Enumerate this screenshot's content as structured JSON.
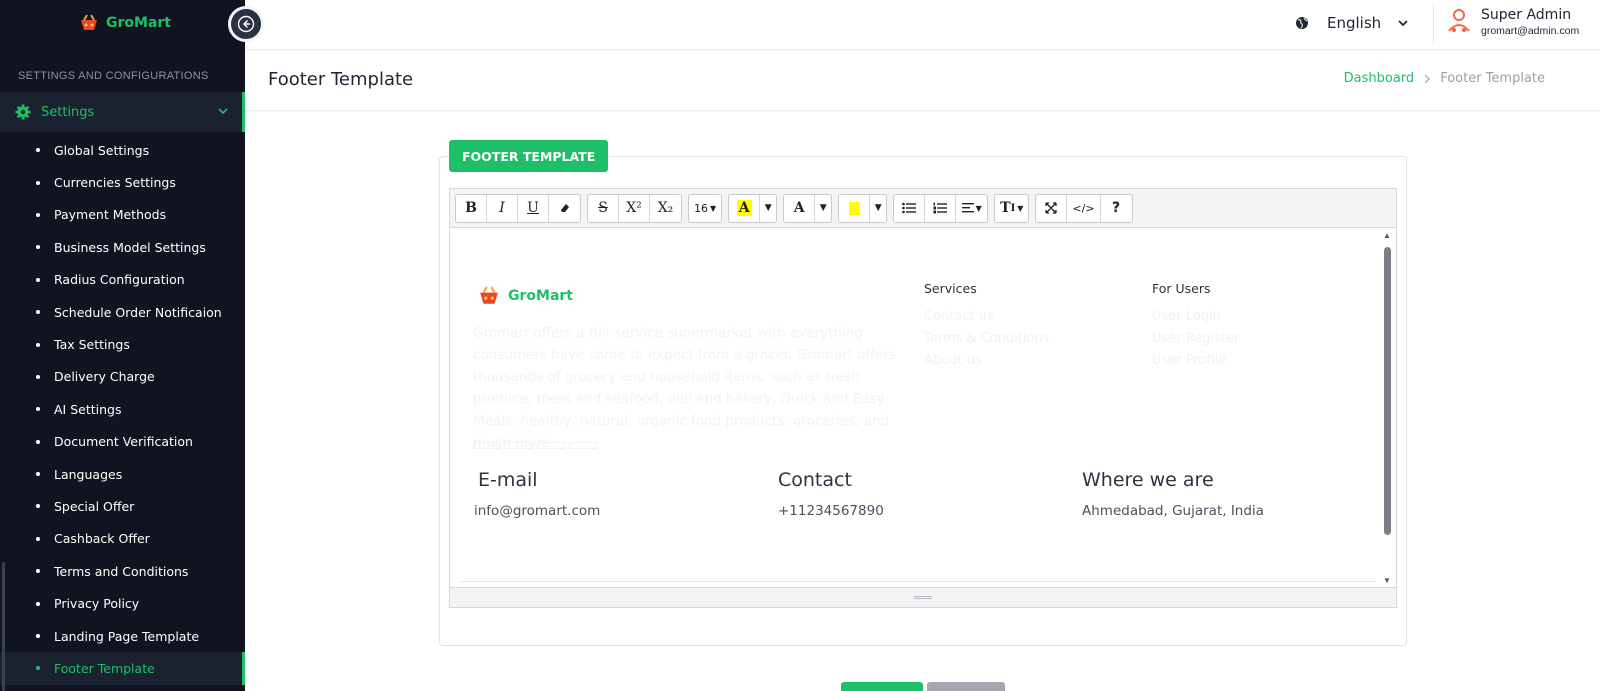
{
  "brand": {
    "name": "GroMart"
  },
  "sidebar": {
    "section_title": "SETTINGS AND CONFIGURATIONS",
    "group_label": "Settings",
    "items": [
      {
        "label": "Global Settings"
      },
      {
        "label": "Currencies Settings"
      },
      {
        "label": "Payment Methods"
      },
      {
        "label": "Business Model Settings"
      },
      {
        "label": "Radius Configuration"
      },
      {
        "label": "Schedule Order Notificaion"
      },
      {
        "label": "Tax Settings"
      },
      {
        "label": "Delivery Charge"
      },
      {
        "label": "AI Settings"
      },
      {
        "label": "Document Verification"
      },
      {
        "label": "Languages"
      },
      {
        "label": "Special Offer"
      },
      {
        "label": "Cashback Offer"
      },
      {
        "label": "Terms and Conditions"
      },
      {
        "label": "Privacy Policy"
      },
      {
        "label": "Landing Page Template"
      },
      {
        "label": "Footer Template"
      }
    ]
  },
  "topbar": {
    "language": "English",
    "user_name": "Super Admin",
    "user_email": "gromart@admin.com"
  },
  "page": {
    "title": "Footer Template",
    "breadcrumb": {
      "home": "Dashboard",
      "current": "Footer Template"
    }
  },
  "card": {
    "tab_label": "FOOTER TEMPLATE"
  },
  "toolbar": {
    "bold": "B",
    "italic": "I",
    "underline": "U",
    "strike": "S",
    "superscript": "X²",
    "subscript": "X₂",
    "font_size": "16",
    "font_color": "A",
    "help": "?",
    "code": "</>"
  },
  "footer_preview": {
    "brand": "GroMart",
    "description": "Gromart offers a full-service supermarket with everything consumers have come to expect from a grocer. Gromart offers thousands of grocery and household items, such as fresh produce, meat and seafood, deli and bakery, Quick and Easy Meals, healthy, natural, organic food products, groceries, and much more.",
    "services": {
      "heading": "Services",
      "links": [
        "Contact us",
        "Terms & Conditions",
        "About us"
      ]
    },
    "for_users": {
      "heading": "For Users",
      "links": [
        "User Login",
        "User Register",
        "User Profile"
      ]
    },
    "email": {
      "heading": "E-mail",
      "value": "info@gromart.com"
    },
    "contact": {
      "heading": "Contact",
      "value": "+11234567890"
    },
    "location": {
      "heading": "Where we are",
      "value": "Ahmedabad, Gujarat, India"
    }
  },
  "colors": {
    "accent": "#1fbf6a",
    "sidebar_bg": "#0f1420"
  }
}
